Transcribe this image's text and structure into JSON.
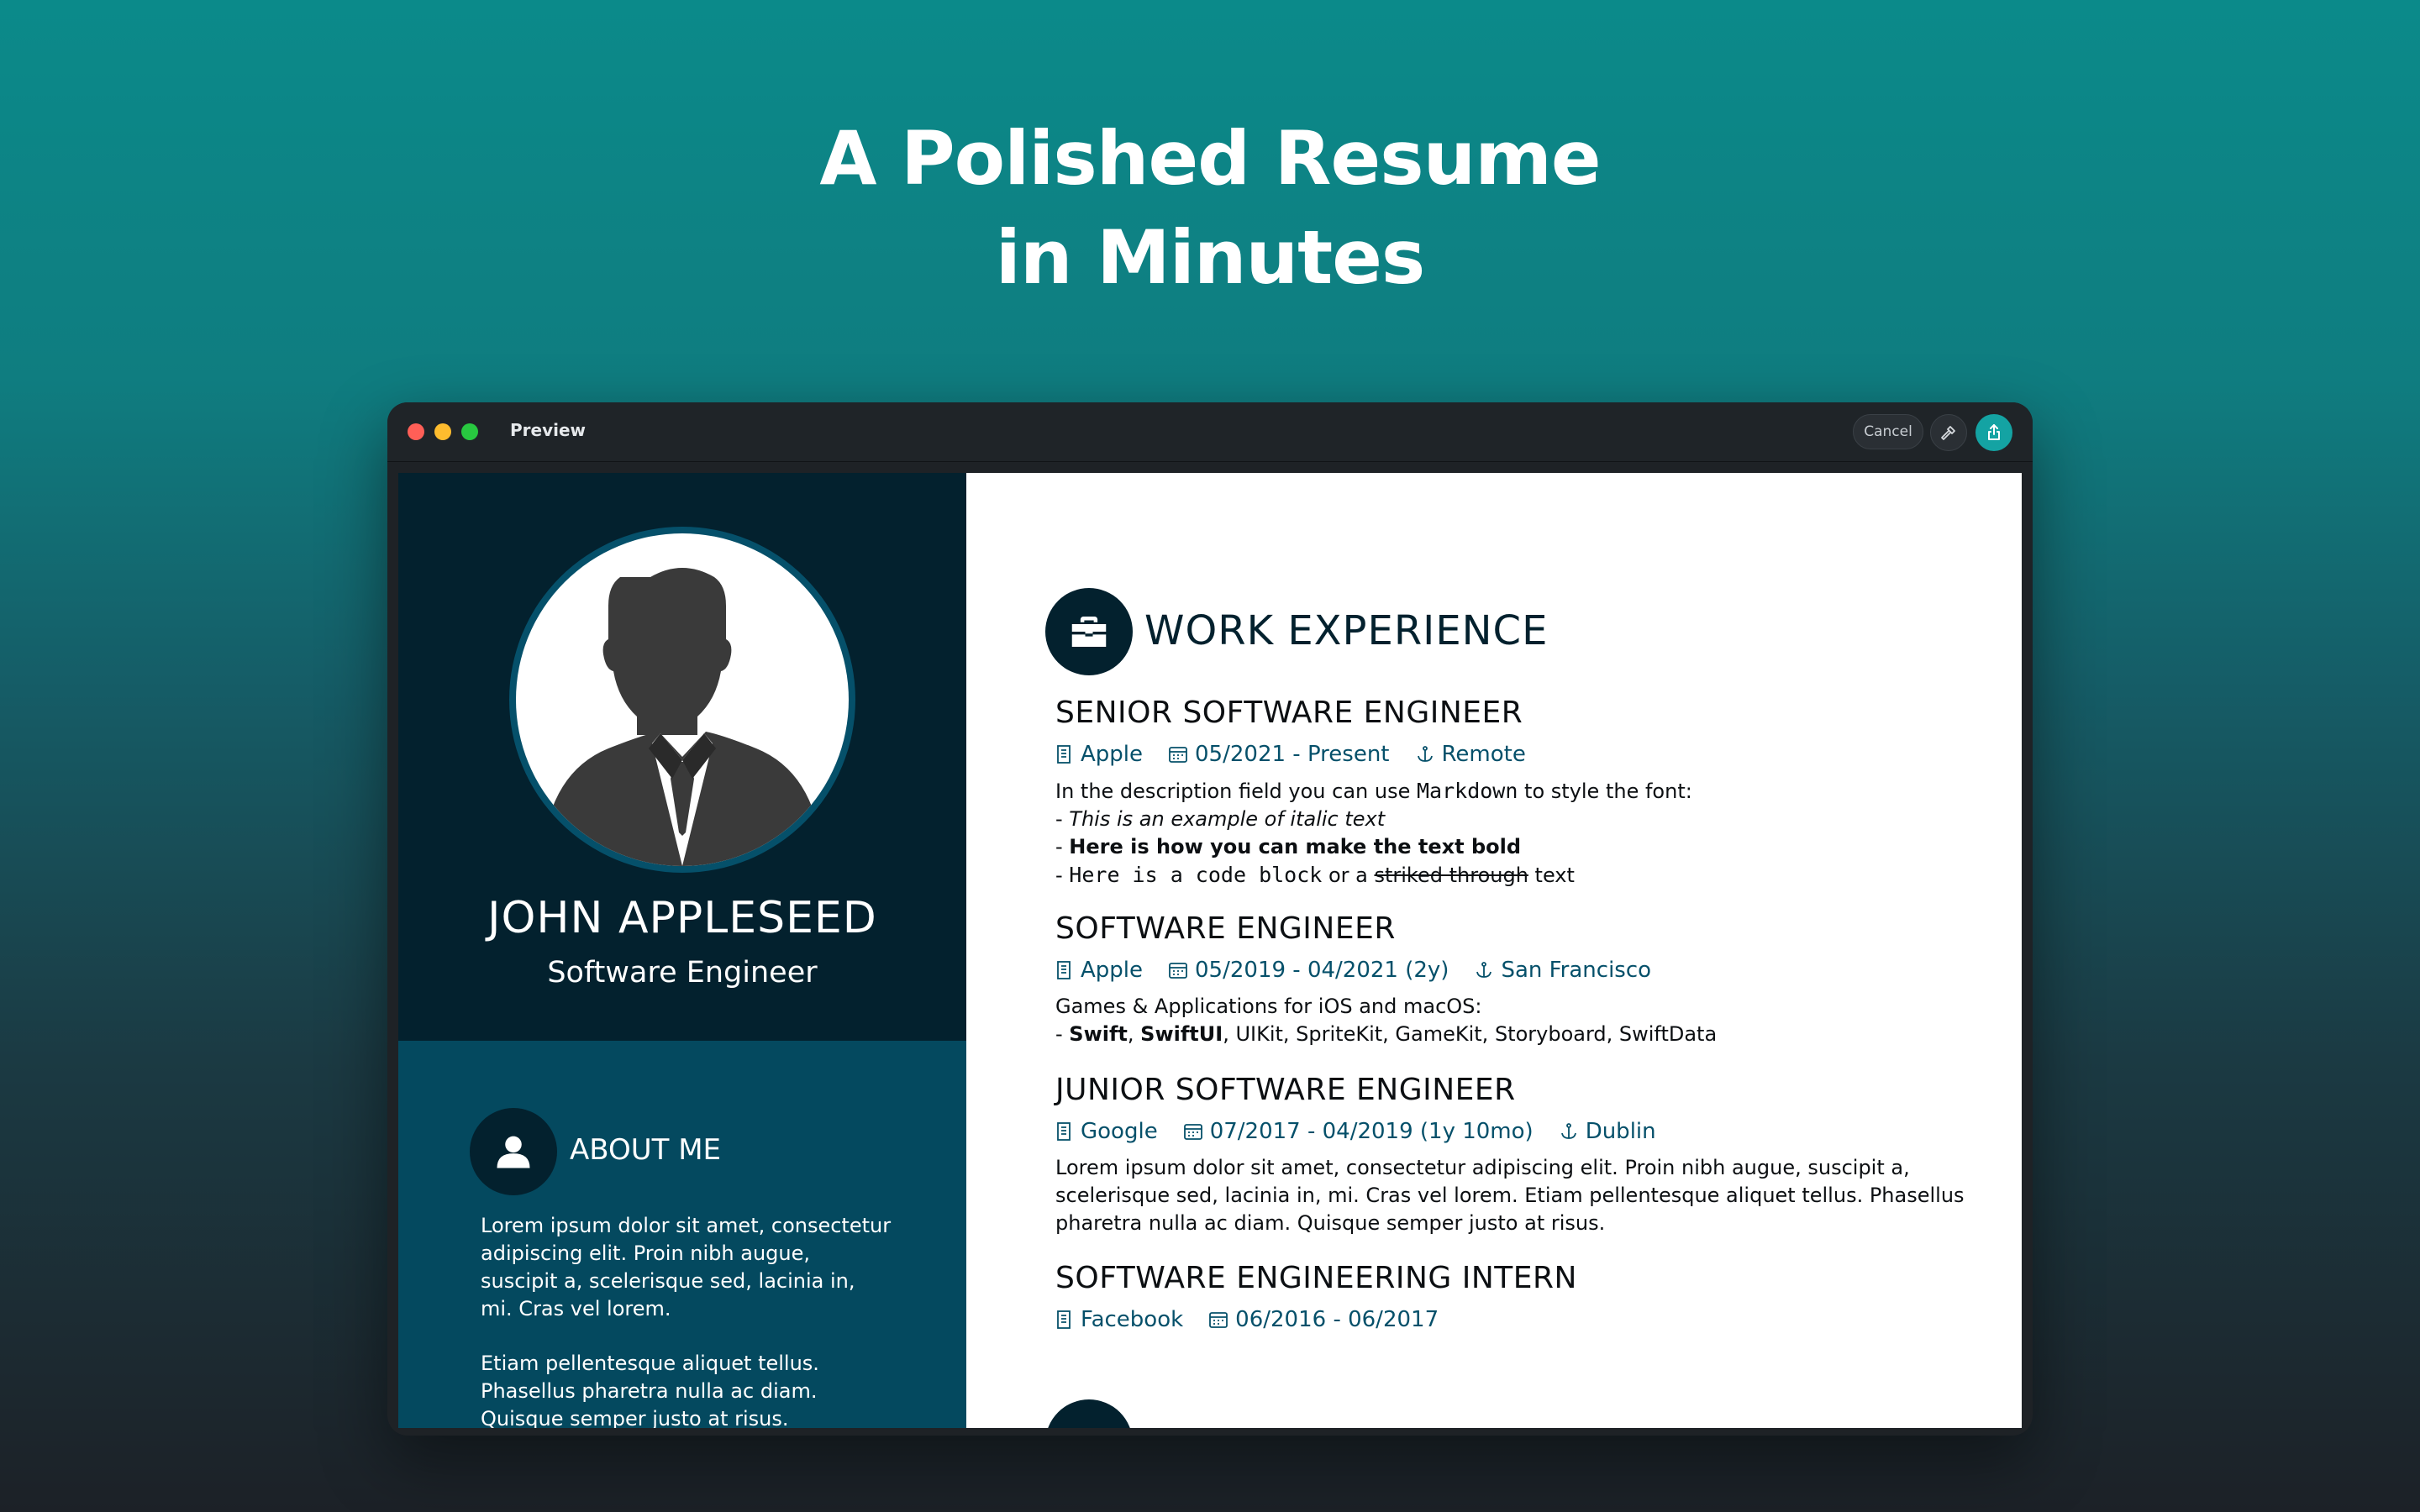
{
  "headline": {
    "line1": "A Polished Resume",
    "line2": "in Minutes"
  },
  "window": {
    "title": "Preview",
    "cancel_label": "Cancel",
    "hammer_icon": "hammer-icon",
    "share_icon": "share-icon"
  },
  "resume": {
    "name": "JOHN APPLESEED",
    "role": "Software Engineer",
    "about": {
      "title": "ABOUT ME",
      "paragraph1": "Lorem ipsum dolor sit amet, consectetur adipiscing elit. Proin nibh augue, suscipit a, scelerisque sed, lacinia in, mi. Cras vel lorem.",
      "paragraph2": "Etiam pellentesque aliquet tellus. Phasellus pharetra nulla ac diam. Quisque semper justo at risus."
    },
    "work": {
      "title": "WORK EXPERIENCE",
      "jobs": [
        {
          "title": "SENIOR SOFTWARE ENGINEER",
          "company": "Apple",
          "dates": "05/2021 - Present",
          "location": "Remote",
          "desc_intro_a": "In the description field you can use ",
          "desc_intro_code": "Markdown",
          "desc_intro_b": " to style the font:",
          "desc_italic": "This is an example of italic text",
          "desc_bold": "Here is how you can make the text bold",
          "desc_code": "Here is a code block",
          "desc_or": " or a ",
          "desc_strike": "striked through",
          "desc_end": " text"
        },
        {
          "title": "SOFTWARE ENGINEER",
          "company": "Apple",
          "dates": "05/2019 - 04/2021 (2y)",
          "location": "San Francisco",
          "desc_line1": "Games & Applications for iOS and macOS:",
          "desc_bold1": "Swift",
          "desc_bold2": "SwiftUI",
          "desc_rest": ", UIKit, SpriteKit, GameKit, Storyboard, SwiftData"
        },
        {
          "title": "JUNIOR SOFTWARE ENGINEER",
          "company": "Google",
          "dates": "07/2017 - 04/2019 (1y 10mo)",
          "location": "Dublin",
          "desc": "Lorem ipsum dolor sit amet, consectetur adipiscing elit. Proin nibh augue, suscipit a, scelerisque sed, lacinia in, mi. Cras vel lorem. Etiam pellentesque aliquet tellus. Phasellus pharetra nulla ac diam. Quisque semper justo at risus."
        },
        {
          "title": "SOFTWARE ENGINEERING INTERN",
          "company": "Facebook",
          "dates": "06/2016 - 06/2017"
        }
      ]
    }
  },
  "colors": {
    "accent": "#14a3a3",
    "sidebar_dark": "#03212e",
    "sidebar_blue": "#04495f",
    "meta_text": "#05506a"
  }
}
